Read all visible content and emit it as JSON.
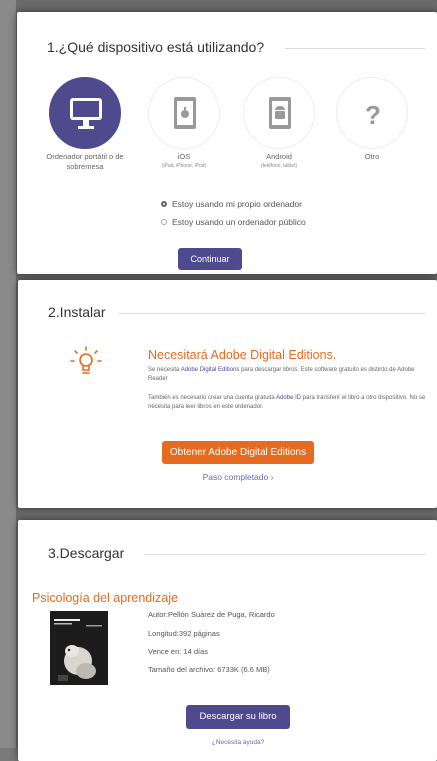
{
  "step1": {
    "title": "1.¿Qué dispositivo está utilizando?",
    "devices": [
      {
        "label": "Ordenador portátil o de sobremesa",
        "sub": "",
        "icon": "monitor-icon",
        "selected": true
      },
      {
        "label": "iOS",
        "sub": "(iPad, iPhone, iPod)",
        "icon": "apple-icon",
        "selected": false
      },
      {
        "label": "Android",
        "sub": "(teléfono, tablet)",
        "icon": "android-icon",
        "selected": false
      },
      {
        "label": "Otro",
        "sub": "",
        "icon": "question-icon",
        "selected": false
      }
    ],
    "radio_own": "Estoy usando mi propio ordenador",
    "radio_public": "Estoy usando un ordenador público",
    "continue": "Continuar"
  },
  "step2": {
    "title": "2.Instalar",
    "heading": "Necesitará Adobe Digital Editions.",
    "p1_pre": "Se necesita ",
    "p1_link": "Adobe Digital Editions",
    "p1_post": " para descargar libros. Este software gratuito es distinto de Adobe Reader",
    "p2_pre": "También es necesario crear una cuenta gratuita ",
    "p2_link": "Adobe ID",
    "p2_post": " para transferir el libro a otro dispositivo. No se necesita para leer libros en este ordenador.",
    "button": "Obtener Adobe Digital Editions",
    "done": "Paso completado ›"
  },
  "step3": {
    "title": "3.Descargar",
    "book_title": "Psicología del aprendizaje",
    "author": "Autor:Pellón Suárez de Puga, Ricardo",
    "length": "Longitud:392 páginas",
    "expires": "Vence en: 14 días",
    "size": "Tamaño del archivo: 6733K (6.6 MB)",
    "button": "Descargar su libro",
    "help": "¿Necesita ayuda?"
  },
  "colors": {
    "accent": "#4d4a8e",
    "orange": "#e66b1f"
  }
}
